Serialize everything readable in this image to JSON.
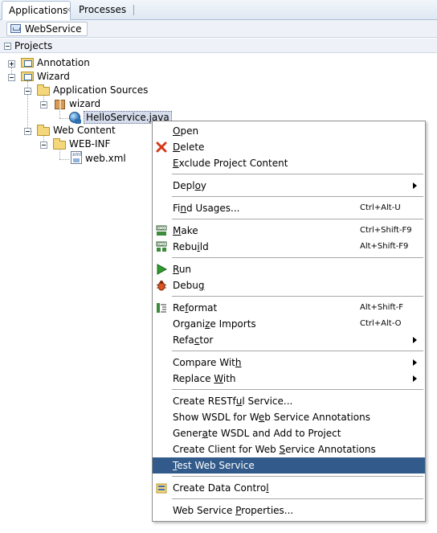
{
  "tabs": [
    {
      "label": "Applications",
      "close": "×",
      "active": true
    },
    {
      "label": "Processes",
      "active": false
    }
  ],
  "toolbar": {
    "project_label": "WebService"
  },
  "projects_header": {
    "label": "Projects"
  },
  "tree": {
    "annotation": "Annotation",
    "wizard": "Wizard",
    "application_sources": "Application Sources",
    "wizard_pkg": "wizard",
    "hello_service": "HelloService.java",
    "web_content": "Web Content",
    "web_inf": "WEB-INF",
    "web_xml": "web.xml"
  },
  "menu": {
    "open": {
      "pre": "",
      "u": "O",
      "post": "pen"
    },
    "delete": {
      "pre": "",
      "u": "D",
      "post": "elete"
    },
    "exclude": {
      "pre": "",
      "u": "E",
      "post": "xclude Project Content"
    },
    "deploy": {
      "pre": "Depl",
      "u": "o",
      "post": "y"
    },
    "find_usages": {
      "pre": "Fi",
      "u": "n",
      "post": "d Usages...",
      "shortcut": "Ctrl+Alt-U"
    },
    "make": {
      "pre": "",
      "u": "M",
      "post": "ake",
      "shortcut": "Ctrl+Shift-F9"
    },
    "rebuild": {
      "pre": "Rebu",
      "u": "i",
      "post": "ld",
      "shortcut": "Alt+Shift-F9"
    },
    "run": {
      "pre": "",
      "u": "R",
      "post": "un"
    },
    "debug": {
      "pre": "Debu",
      "u": "g",
      "post": ""
    },
    "reformat": {
      "pre": "Re",
      "u": "f",
      "post": "ormat",
      "shortcut": "Alt+Shift-F"
    },
    "organize": {
      "pre": "Organi",
      "u": "z",
      "post": "e Imports",
      "shortcut": "Ctrl+Alt-O"
    },
    "refactor": {
      "pre": "Refa",
      "u": "c",
      "post": "tor"
    },
    "compare": {
      "pre": "Compare Wit",
      "u": "h",
      "post": ""
    },
    "replace": {
      "pre": "Replace ",
      "u": "W",
      "post": "ith"
    },
    "create_rest": {
      "pre": "Create RESTf",
      "u": "u",
      "post": "l Service..."
    },
    "show_wsdl": {
      "pre": "Show WSDL for W",
      "u": "e",
      "post": "b Service Annotations"
    },
    "gen_wsdl": {
      "pre": "Gener",
      "u": "a",
      "post": "te WSDL and Add to Project"
    },
    "create_client": {
      "pre": "Create Client for Web ",
      "u": "S",
      "post": "ervice Annotations"
    },
    "test_ws": {
      "pre": "",
      "u": "T",
      "post": "est Web Service"
    },
    "create_dc": {
      "pre": "Create Data Contro",
      "u": "l",
      "post": ""
    },
    "ws_props": {
      "pre": "Web Service ",
      "u": "P",
      "post": "roperties..."
    }
  },
  "colors": {
    "highlight": "#325b8b",
    "tab_border": "#a9bdd6"
  }
}
